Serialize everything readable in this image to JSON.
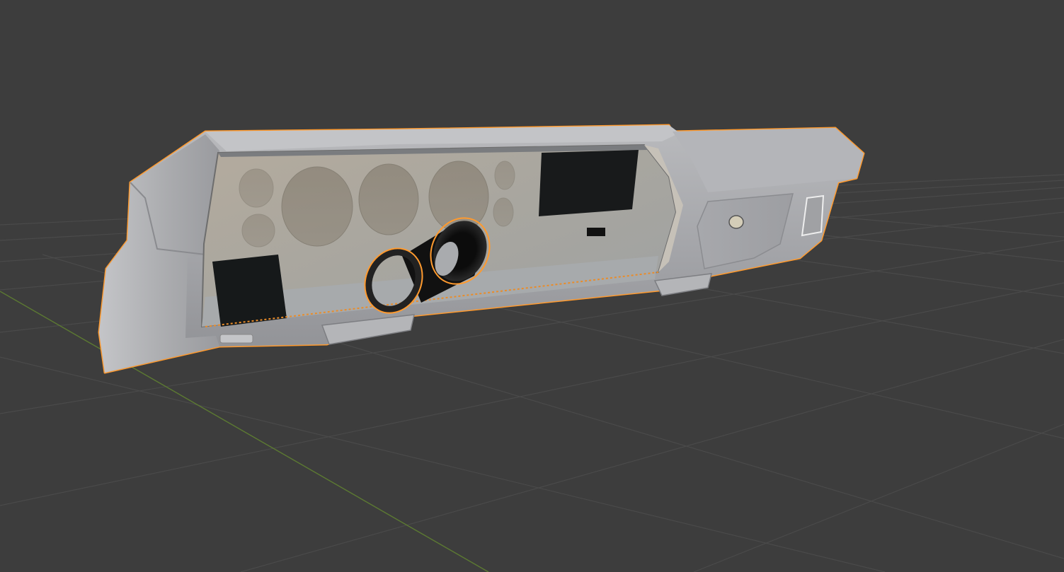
{
  "viewport": {
    "background": "#3d3d3d",
    "grid_line_color": "#4a4a4a",
    "x_axis_color": "#5c7a32",
    "selection_outline_color": "#ff9a2e"
  },
  "scene": {
    "objects": [
      {
        "name": "dashboard",
        "selected": true,
        "material_color": "#a8a9ad"
      },
      {
        "name": "steering-column",
        "selected": true,
        "material_color": "#1a1a1a"
      }
    ]
  }
}
